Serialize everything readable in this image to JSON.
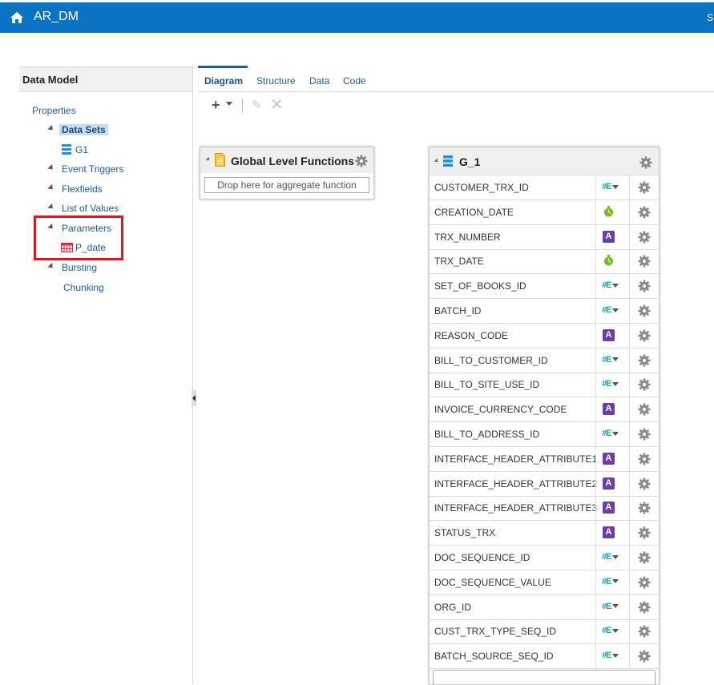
{
  "app": {
    "title": "AR_DM",
    "top_right": "S"
  },
  "left_panel": {
    "title": "Data Model",
    "properties": "Properties",
    "data_sets": "Data Sets",
    "g1": "G1",
    "event_triggers": "Event Triggers",
    "flexfields": "Flexfields",
    "list_of_values": "List of Values",
    "parameters": "Parameters",
    "p_date": "P_date",
    "bursting": "Bursting",
    "chunking": "Chunking"
  },
  "tabs": [
    "Diagram",
    "Structure",
    "Data",
    "Code"
  ],
  "toolbar": {
    "add": "+",
    "edit": "✎",
    "delete": "✕"
  },
  "global_functions": {
    "title": "Global Level Functions",
    "drop_text": "Drop here for aggregate function"
  },
  "group": {
    "title": "G_1",
    "columns": [
      {
        "name": "CUSTOMER_TRX_ID",
        "type": "number"
      },
      {
        "name": "CREATION_DATE",
        "type": "date"
      },
      {
        "name": "TRX_NUMBER",
        "type": "string"
      },
      {
        "name": "TRX_DATE",
        "type": "date"
      },
      {
        "name": "SET_OF_BOOKS_ID",
        "type": "number"
      },
      {
        "name": "BATCH_ID",
        "type": "number"
      },
      {
        "name": "REASON_CODE",
        "type": "string"
      },
      {
        "name": "BILL_TO_CUSTOMER_ID",
        "type": "number"
      },
      {
        "name": "BILL_TO_SITE_USE_ID",
        "type": "number"
      },
      {
        "name": "INVOICE_CURRENCY_CODE",
        "type": "string"
      },
      {
        "name": "BILL_TO_ADDRESS_ID",
        "type": "number"
      },
      {
        "name": "INTERFACE_HEADER_ATTRIBUTE1",
        "type": "string"
      },
      {
        "name": "INTERFACE_HEADER_ATTRIBUTE2",
        "type": "string"
      },
      {
        "name": "INTERFACE_HEADER_ATTRIBUTE3",
        "type": "string"
      },
      {
        "name": "STATUS_TRX",
        "type": "string"
      },
      {
        "name": "DOC_SEQUENCE_ID",
        "type": "number"
      },
      {
        "name": "DOC_SEQUENCE_VALUE",
        "type": "number"
      },
      {
        "name": "ORG_ID",
        "type": "number"
      },
      {
        "name": "CUST_TRX_TYPE_SEQ_ID",
        "type": "number"
      },
      {
        "name": "BATCH_SOURCE_SEQ_ID",
        "type": "number"
      }
    ]
  },
  "type_badges": {
    "string": "A",
    "number": "#E"
  },
  "colors": {
    "header_bar": "#0a73c3",
    "highlight_box": "#e0141e",
    "string_badge": "#6c3fa0",
    "number_badge": "#1aa3b3",
    "date_badge": "#7ab929"
  }
}
